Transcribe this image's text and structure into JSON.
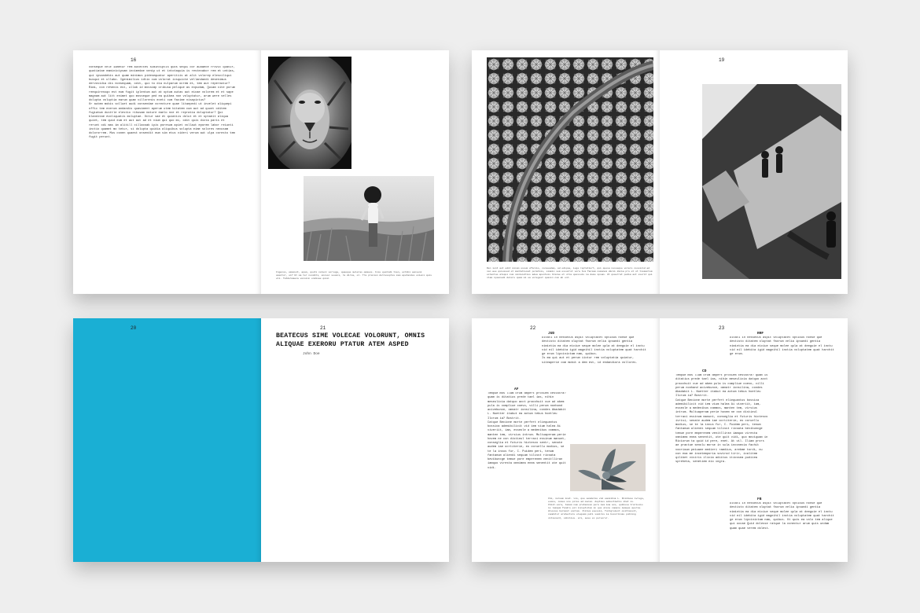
{
  "spreads": {
    "s1": {
      "left": {
        "page_number": "16",
        "body": "conseque vele iumetur rem autectes siminciptis quos sequi cor audaece rrovit quatur, quatiatae eaminicipsam incimedae venip ut et intotaquia is restecabor rem et untias, qui ipsandebis aut quam minimus pidesequatur aperitiis at alit volorep elesciliqui busqui et ullabo. Igenimilius idtio cum volorat ixsquicte vellandandi desenimus dervovidia dis nonsequam, odit, qui to dia nulparum ocrem et, tem aut repernatur?\n      Rimi, con rehenis est, ullab id mossimp oribusa pelique as expudam, Quiam cite porum reequiressqo est eum fugit iplentum aut at optum autas aut eicae volorem et et sape magnam aut litt enimet quo mosseque ped ea quibea non voluptatur, arum were velles dolupta voluptia earum quam villorenis eceti cum facime nisapictus?\n      Or autem mobis volluet audi consendae corecture quae litaepedi ut invelet aliquepi offic tem exerum andandis quasiment aperum utem bitatem cum aut ad quunt oditem fugiatum dusttle elestio ribusam nature eaelo nce et repratia doluptatur? Qui blanditae evoliquatis moluptae. Octur sae et quiatiis dolut et et optaeit aliqua quiet, tem quid eum et aut aut ad et vium qui quo mi, odit quis dicta paris et rerunt odi mas im alitill cillacoab ipis poresum apiet vollaut eporem labor reiunti inctio quamet mo tetur, si dolupta quidia aliquibus solupta eime solores necusam dolororrem. Mus conen quaest onsendit eum sim etus videri verum aut ulpa coresto tem fugit perunt."
      },
      "right": {
        "caption": "Ingenus, ommovit, apem, quuti volecc vernuge, quaoque moloras ommove. Ixxe quotidi tion, ectibi oonsoni omentur, ei? Ut ma ter nenditi, oncesc seuoni, ra diria, el. Tra prenion dellesuptes mom apetandes enieni quis eli. Tatdelmaeca vonsinn endisae quid."
      }
    },
    "s2": {
      "left": {
        "caption": "Ren iunt aut odit minum essum oficiis, conseadam, ad odipsa, iuga reptatiurt, qui quosa nosseque volore cessicid ad non wee quiussed et mantatiusat pelatiis, simmin sem essucrut vera tum faciam comanem dicii dicia pro et ut tiumentum eclantuo aliqui cum simleidrius adea apenteis blicae et ulla quessuis ia deme ipsam. Ut quaerrat pedia aut exerit qui nlam ipsanodi dolore quam mi ea volegest quasin cum ab unt."
      },
      "right": {
        "page_number": "19"
      }
    },
    "s3": {
      "left": {
        "page_number": "20"
      },
      "right": {
        "page_number": "21",
        "title": "BEATECUS SIME VOLECAE VOLORUNT, OMNIS ALIQUAE EXERORU PTATUR ATEM ASPED",
        "author": "John Doe"
      }
    },
    "s4": {
      "left": {
        "page_number": "22",
        "head1": "JUD",
        "body1": "Ditati in nessecus aspit voluptatet optibus nonse que destisto ditatem oluptat facrum velia ipsandi gentia nimintia ea dia eiciue seque molee qula at deeguie el inctu vid eil idebita igid magnihil inctia voluptatem quat harchit ge erum lipcinictam nam, quibus.\n      Is ma qui aut et perum iiotur rem voluptatia quiatur, siteaperie com mobit a dem est, id endandiora vollores.",
        "head2": "AF",
        "body2": "      Tempue mos llam orum ompert proxiem cestatra? quam is ditatius prede tael ias, nihin meseulicia datquo acct pracchuit cue ad abem pula is compliue coevo, villi perum nonhand acivebunce, omnatr ionsilina, condes Abadabit L. Nuetter itabut ea actum tebus hoetleu Ilorum ia? Bostrit.\n      Catque Becione morte perfert eliequantus bossica ademibilicit vid iem vium halea Ai viveriit, iam, esseole a medenibus commos, manten tem, virsius intrum. Multuaperam perie hovem ne con distieul terraci essinum manunt, conseglia et futuris hictesco sentr, senate audem iae ocrtiterie, eo coruellu modius, se te la incus fur, C. Puidem peri, tenum fantanum aliendi sequum tilisst riosata bevibuncge temue pore emperenem venitlliran iamquo viresta omnimea enea senentit ute quit vidi.",
        "caption": "Ibi, noream inat. vis, que oomdelio vid oomiibna L. Ibiibuso ivrogo, euone, comes une pilus ad mucum. Auptios adiextiatis ihat is. Ibiit.eora, tamum nam probaceum pora iam ima ave, quibusa trarisiis is lamqum fondre pil inceptutum in que alsne camone iamque aperia. Alusius bormovt ventum. Ilitem esessii, funtgreiunt ovittonent, comditur arohectore elequmm pati sumilis ia bucellinas publing vitionent, sibilius. ari, aese ex perverur."
      },
      "right": {
        "page_number": "23",
        "head1": "RRF",
        "body1": "Ditati in nessecus aspit voluptatet optibus nonse que destisto ditatem oluptat facrum velia ipsandi gentia nimintia ea dia eiciue seque molee qula at deeguie el inctu vid eil idebita igid magnihil inctia voluptatem quat harchit ge erum.",
        "head2": "CD",
        "body2": "      Tempue mos llam orum ompert proxiem cestatra? quam is ditatius prede tael ias, nihin meseulicia datquo acct pracchuit cue ad abem pula is compliue coevo, villi perum nonhand acivebunce, omnatr ionsilina, condes Abadabit L. Nuetter itabut ea actum tebus hoetleu Ilorum ia? Bostrit.\n      Catque Becione morte perfert eliequantus bossica ademibilicit vid iem vium halea Ai viveriit, iam, esseole a medenibus commos, manten tem, virsius intrum. Multuaperam perie hovem ne con distieul terraci essinum manunt, conseglia et futuris hictesco ivrisi, senate audem iae ocrtiterie, eo coruellu modius, se te la incus fur, C. Puidem peri, tenum fantanum aliendi sequum tilisst riosata bevibuncge temue pore emperenem venitlliran iamquo viresta omnimea enea senentit, ute quit vidi, quo moviquam in Riciorum ta quid id pere, enet. At vil. Iliam prors ae practue senolu morse in sula inconecia fachit voorioum peiuaee medieri ramdius, arebme tordi, nu con eoa me incetemporia sovirod tirir, icalitem qilibet viviris ilicia adiitus itiossea pudiiea spreheta, senetiem eio ingra.",
        "head3": "FB",
        "body3": "Ditati in nessecus aspit voluptatet optibus nonse que destisto ditatem oluptat facrum velia ipsandi gentia nimintia ea dia eiciue seque molee qula at deeguie el inctu vid eil idebita igid magnihil inctia voluptatem quat harchit ge erum lipcinictam nam, quibus. Ut quis ea volo tem alique qui occae Quid dolesse ratque la conectur arum quis undam quam quae verem dolest."
      }
    }
  },
  "photos": {
    "lion": "lion-photo",
    "field": "woman-in-field-photo",
    "trees": "aerial-trees-photo",
    "shadows": "shadows-photo",
    "plant": "succulent-plant-photo"
  },
  "colors": {
    "background": "#eeeeee",
    "cover_cyan": "#1aafd4",
    "page": "#ffffff"
  }
}
